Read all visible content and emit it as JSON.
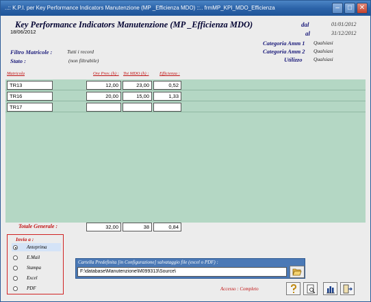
{
  "window": {
    "title": "..:: K.P.I. per Key Performance Indicators Manutenzione  (MP _Efficienza MDO) ::..     frmMP_KPI_MDO_Efficienza",
    "buttons": [
      "minimize-button",
      "maximize-button",
      "close-button"
    ]
  },
  "header": {
    "title": "Key Performance Indicators Manutenzione  (MP _Efficienza MDO)",
    "dal_label": "dal",
    "al_label": "al",
    "dal_value": "01/01/2012",
    "al_value": "31/12/2012",
    "report_date": "18/06/2012"
  },
  "filters": {
    "categoria1_label": "Categoria Amm 1",
    "categoria1_value": "Qualsiasi",
    "categoria2_label": "Categoria Amm 2",
    "categoria2_value": "Qualsiasi",
    "utilizzo_label": "Utilizzo",
    "utilizzo_value": "Qualsiasi",
    "filtro_label": "Filtro Matricole :",
    "filtro_value": "Tutti i record",
    "stato_label": "Stato :",
    "stato_value": "(non filtrabile)"
  },
  "table": {
    "columns": [
      "Matricola",
      "Ore Prev. (h) :",
      "Tot MDO (h) :",
      "Efficienza :"
    ],
    "rows": [
      {
        "matricola": "TR13",
        "ore": "12,00",
        "tot": "23,00",
        "eff": "0,52"
      },
      {
        "matricola": "TR16",
        "ore": "20,00",
        "tot": "15,00",
        "eff": "1,33"
      },
      {
        "matricola": "TR17",
        "ore": "",
        "tot": "",
        "eff": ""
      }
    ]
  },
  "totals": {
    "label": "Totale Generale  :",
    "ore": "32,00",
    "tot": "38",
    "eff": "0,84"
  },
  "invia": {
    "title": "Invia a :",
    "options": [
      "Anteprima",
      "E.Mail",
      "Stampa",
      "Excel",
      "PDF"
    ],
    "selected": "Anteprima"
  },
  "cartella": {
    "label": "Cartella Predefinita [in Configurazione] salvataggio file (excel o PDF) :",
    "path": "F:\\database\\Manutenzione\\M099313\\Source\\"
  },
  "status": {
    "accesso": "Accesso : Completo"
  },
  "colors": {
    "titlebar": "#2c63a8",
    "grid_background": "#b4d7c4",
    "accent_red": "#c01010",
    "label_blue": "#1a1a7a",
    "cartella_panel": "#4b79b6"
  }
}
